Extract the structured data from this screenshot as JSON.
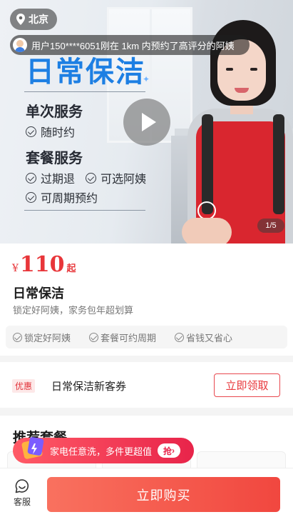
{
  "banner": {
    "city": "北京",
    "notice": "用户150****6051刚在 1km 内预约了高评分的阿姨",
    "ad_title": "日常保洁",
    "section1_title": "单次服务",
    "section1_items": [
      "随时约"
    ],
    "section2_title": "套餐服务",
    "section2_items": [
      "过期退",
      "可选阿姨",
      "可周期预约"
    ],
    "page_indicator": "1/5"
  },
  "product": {
    "currency": "¥",
    "price": "110",
    "price_suffix": "起",
    "name": "日常保洁",
    "subtitle": "锁定好阿姨，家务包年超划算",
    "tags": [
      "锁定好阿姨",
      "套餐可约周期",
      "省钱又省心"
    ]
  },
  "coupon": {
    "badge": "优惠",
    "label": "日常保洁新客券",
    "button": "立即领取"
  },
  "recommend": {
    "title": "推荐套餐"
  },
  "promo": {
    "text": "家电任意洗，多件更超值",
    "grab": "抢"
  },
  "bottom_bar": {
    "service_label": "客服",
    "buy_label": "立即购买"
  },
  "colors": {
    "accent": "#e8363a",
    "brand_blue": "#1d7fe3",
    "buy_gradient_start": "#f9715f",
    "buy_gradient_end": "#f1473f"
  }
}
